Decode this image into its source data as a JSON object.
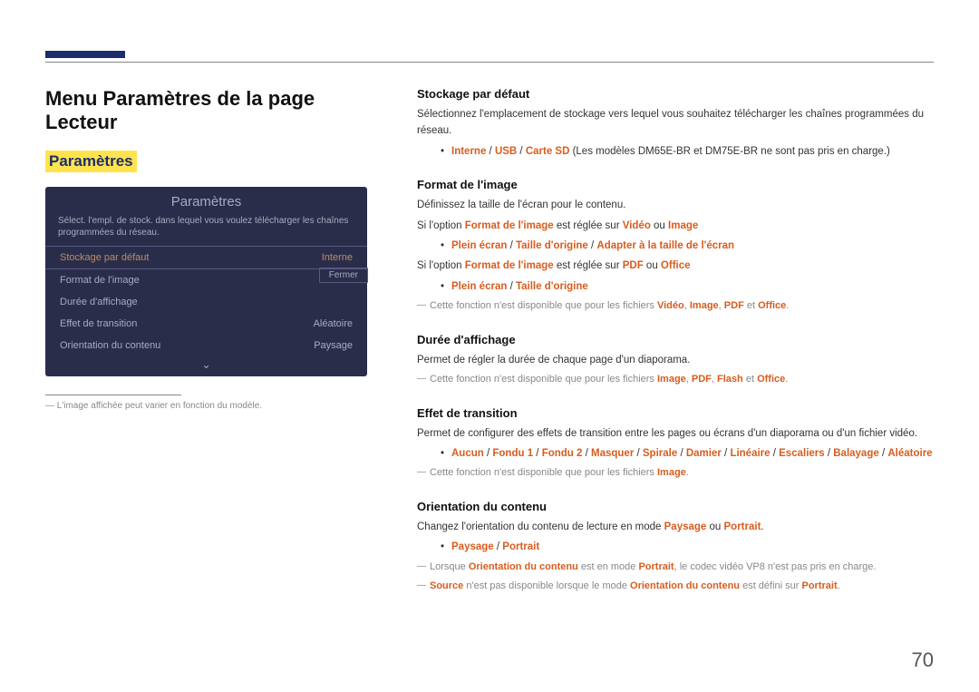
{
  "page_number": "70",
  "title": "Menu Paramètres de la page Lecteur",
  "section_title": "Paramètres",
  "screenshot": {
    "title": "Paramètres",
    "desc": "Sélect. l'empl. de stock. dans lequel vous voulez télécharger les chaînes programmées du réseau.",
    "rows": [
      {
        "label": "Stockage par défaut",
        "value": "Interne",
        "selected": true
      },
      {
        "label": "Format de l'image",
        "value": ""
      },
      {
        "label": "Durée d'affichage",
        "value": ""
      },
      {
        "label": "Effet de transition",
        "value": "Aléatoire"
      },
      {
        "label": "Orientation du contenu",
        "value": "Paysage"
      }
    ],
    "close": "Fermer"
  },
  "footnote": "L'image affichée peut varier en fonction du modèle.",
  "s1": {
    "title": "Stockage par défaut",
    "p1": "Sélectionnez l'emplacement de stockage vers lequel vous souhaitez télécharger les chaînes programmées du réseau.",
    "li1_a": "Interne",
    "li1_b": "USB",
    "li1_c": "Carte SD",
    "li1_note": " (Les modèles DM65E-BR et DM75E-BR ne sont pas pris en charge.)"
  },
  "s2": {
    "title": "Format de l'image",
    "p1": "Définissez la taille de l'écran pour le contenu.",
    "p2_a": "Si l'option ",
    "p2_b": "Format de l'image",
    "p2_c": " est réglée sur ",
    "p2_d": "Vidéo",
    "p2_e": " ou ",
    "p2_f": "Image",
    "li1_a": "Plein écran",
    "li1_b": "Taille d'origine",
    "li1_c": "Adapter à la taille de l'écran",
    "p3_a": "Si l'option ",
    "p3_b": "Format de l'image",
    "p3_c": " est réglée sur ",
    "p3_d": "PDF",
    "p3_e": " ou ",
    "p3_f": "Office",
    "li2_a": "Plein écran",
    "li2_b": "Taille d'origine",
    "note_a": "Cette fonction n'est disponible que pour les fichiers ",
    "note_b": "Vidéo",
    "note_c": "Image",
    "note_d": "PDF",
    "note_e": " et ",
    "note_f": "Office"
  },
  "s3": {
    "title": "Durée d'affichage",
    "p1": "Permet de régler la durée de chaque page d'un diaporama.",
    "note_a": "Cette fonction n'est disponible que pour les fichiers ",
    "note_b": "Image",
    "note_c": "PDF",
    "note_d": "Flash",
    "note_e": " et ",
    "note_f": "Office"
  },
  "s4": {
    "title": "Effet de transition",
    "p1": "Permet de configurer des effets de transition entre les pages ou écrans d'un diaporama ou d'un fichier vidéo.",
    "opts": [
      "Aucun",
      "Fondu 1",
      "Fondu 2",
      "Masquer",
      "Spirale",
      "Damier",
      "Linéaire",
      "Escaliers",
      "Balayage",
      "Aléatoire"
    ],
    "note_a": "Cette fonction n'est disponible que pour les fichiers ",
    "note_b": "Image"
  },
  "s5": {
    "title": "Orientation du contenu",
    "p1_a": "Changez l'orientation du contenu de lecture en mode ",
    "p1_b": "Paysage",
    "p1_c": " ou ",
    "p1_d": "Portrait",
    "li1_a": "Paysage",
    "li1_b": "Portrait",
    "note1_a": "Lorsque ",
    "note1_b": "Orientation du contenu",
    "note1_c": " est en mode ",
    "note1_d": "Portrait",
    "note1_e": ", le codec vidéo VP8 n'est pas pris en charge.",
    "note2_a": "Source",
    "note2_b": " n'est pas disponible lorsque le mode ",
    "note2_c": "Orientation du contenu",
    "note2_d": " est défini sur ",
    "note2_e": "Portrait"
  }
}
